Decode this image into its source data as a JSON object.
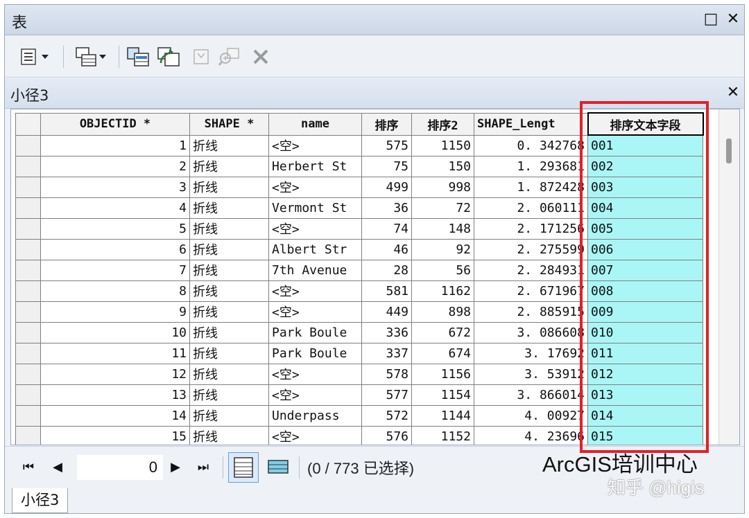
{
  "window": {
    "title": "表",
    "restore_icon": "□",
    "close_icon": "✕"
  },
  "toolbar": {
    "icons": [
      "table-options-icon",
      "related-tables-icon",
      "select-by-attributes-icon",
      "switch-selection-icon",
      "clear-selection-icon",
      "zoom-to-selected-icon",
      "delete-selected-icon"
    ]
  },
  "table_tab": {
    "title": "小径3",
    "close_icon": "✕"
  },
  "columns": [
    "OBJECTID *",
    "SHAPE *",
    "name",
    "排序",
    "排序2",
    "SHAPE_Lengt",
    "排序文本字段"
  ],
  "rows": [
    [
      "1",
      "折线",
      "<空>",
      "575",
      "1150",
      "0. 342768",
      "001"
    ],
    [
      "2",
      "折线",
      "Herbert St",
      "75",
      "150",
      "1. 293681",
      "002"
    ],
    [
      "3",
      "折线",
      "<空>",
      "499",
      "998",
      "1. 872428",
      "003"
    ],
    [
      "4",
      "折线",
      "Vermont St",
      "36",
      "72",
      "2. 060111",
      "004"
    ],
    [
      "5",
      "折线",
      "<空>",
      "74",
      "148",
      "2. 171256",
      "005"
    ],
    [
      "6",
      "折线",
      "Albert Str",
      "46",
      "92",
      "2. 275599",
      "006"
    ],
    [
      "7",
      "折线",
      "7th Avenue",
      "28",
      "56",
      "2. 284931",
      "007"
    ],
    [
      "8",
      "折线",
      "<空>",
      "581",
      "1162",
      "2. 671967",
      "008"
    ],
    [
      "9",
      "折线",
      "<空>",
      "449",
      "898",
      "2. 885915",
      "009"
    ],
    [
      "10",
      "折线",
      "Park Boule",
      "336",
      "672",
      "3. 086608",
      "010"
    ],
    [
      "11",
      "折线",
      "Park Boule",
      "337",
      "674",
      "3. 17692",
      "011"
    ],
    [
      "12",
      "折线",
      "<空>",
      "578",
      "1156",
      "3. 53912",
      "012"
    ],
    [
      "13",
      "折线",
      "<空>",
      "577",
      "1154",
      "3. 866014",
      "013"
    ],
    [
      "14",
      "折线",
      "Underpass",
      "572",
      "1144",
      "4. 00927",
      "014"
    ],
    [
      "15",
      "折线",
      "<空>",
      "576",
      "1152",
      "4. 23696",
      "015"
    ]
  ],
  "nav": {
    "first_icon": "⏮",
    "prev_icon": "◀",
    "record_value": "0",
    "next_icon": "▶",
    "last_icon": "⏭",
    "selection_status": "(0 / 773 已选择)"
  },
  "watermark": {
    "line1": "ArcGIS培训中心",
    "line2": "知乎 @higis"
  },
  "bottom_tab": {
    "label": "小径3"
  },
  "colors": {
    "highlight_column": "#aaf6f6",
    "red_box": "#e41f27"
  }
}
